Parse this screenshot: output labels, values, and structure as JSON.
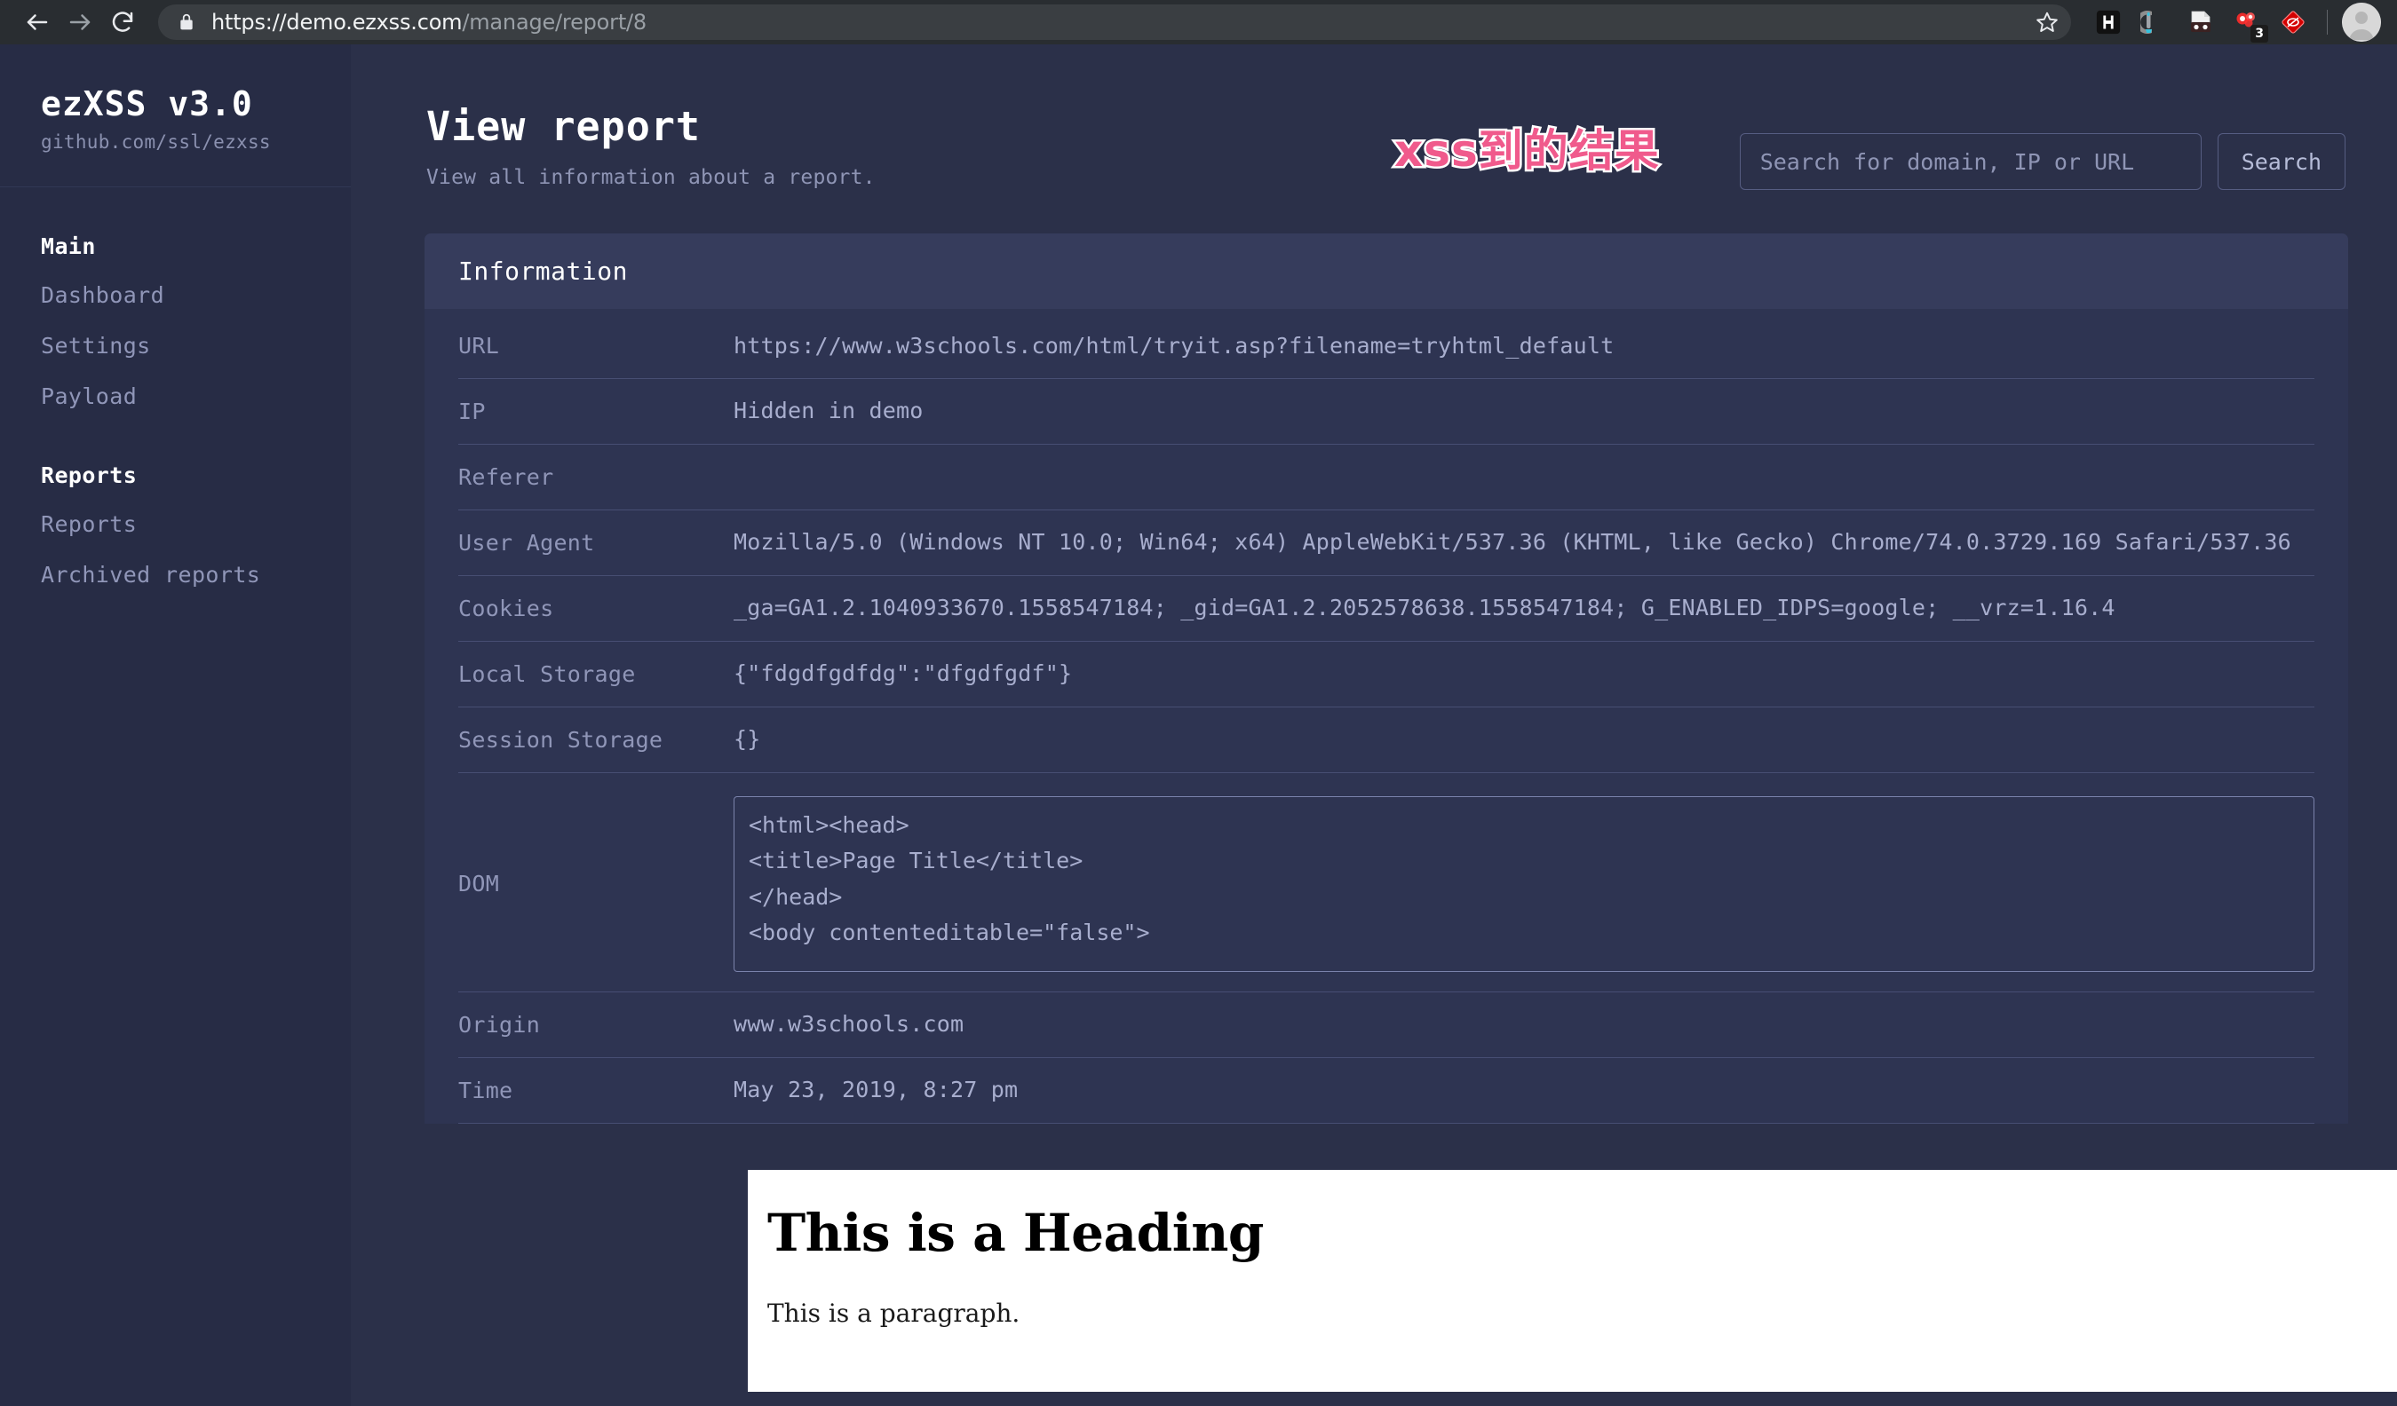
{
  "browser": {
    "back_icon": "back-arrow-icon",
    "forward_icon": "forward-arrow-icon",
    "reload_icon": "reload-icon",
    "lock_icon": "lock-icon",
    "url_scheme_host": "https://demo.ezxss.com",
    "url_path": "/manage/report/8",
    "star_icon": "bookmark-star-icon",
    "extensions": [
      {
        "name": "hackbar-extension-icon",
        "badge": ""
      },
      {
        "name": "wappalyzer-extension-icon",
        "badge": ""
      },
      {
        "name": "proxy-switcher-extension-icon",
        "badge": ""
      },
      {
        "name": "adblock-extension-icon",
        "badge": "3"
      },
      {
        "name": "noscript-extension-icon",
        "badge": ""
      }
    ],
    "profile_icon": "user-avatar-icon"
  },
  "sidebar": {
    "brand_title": "ezXSS v3.0",
    "brand_sub": "github.com/ssl/ezxss",
    "groups": [
      {
        "title": "Main",
        "items": [
          {
            "label": "Dashboard"
          },
          {
            "label": "Settings"
          },
          {
            "label": "Payload"
          }
        ]
      },
      {
        "title": "Reports",
        "items": [
          {
            "label": "Reports"
          },
          {
            "label": "Archived reports"
          }
        ]
      }
    ]
  },
  "header": {
    "title": "View report",
    "subtitle": "View all information about a report.",
    "annotation": "xss到的结果",
    "annotation_color": "#f05a8c",
    "annotation_outline_color": "#ffffff"
  },
  "search": {
    "placeholder": "Search for domain, IP or URL",
    "value": "",
    "button_label": "Search"
  },
  "card": {
    "title": "Information",
    "rows": [
      {
        "label": "URL",
        "value": "https://www.w3schools.com/html/tryit.asp?filename=tryhtml_default"
      },
      {
        "label": "IP",
        "value": "Hidden in demo"
      },
      {
        "label": "Referer",
        "value": ""
      },
      {
        "label": "User Agent",
        "value": "Mozilla/5.0 (Windows NT 10.0; Win64; x64) AppleWebKit/537.36 (KHTML, like Gecko) Chrome/74.0.3729.169 Safari/537.36"
      },
      {
        "label": "Cookies",
        "value": "_ga=GA1.2.1040933670.1558547184; _gid=GA1.2.2052578638.1558547184; G_ENABLED_IDPS=google; __vrz=1.16.4"
      },
      {
        "label": "Local Storage",
        "value": "{\"fdgdfgdfdg\":\"dfgdfgdf\"}"
      },
      {
        "label": "Session Storage",
        "value": "{}"
      }
    ],
    "dom_label": "DOM",
    "dom_value": "<html><head>\n<title>Page Title</title>\n</head>\n<body contenteditable=\"false\">\n",
    "tail_rows": [
      {
        "label": "Origin",
        "value": "www.w3schools.com"
      },
      {
        "label": "Time",
        "value": "May 23, 2019, 8:27 pm"
      }
    ]
  },
  "screenshot": {
    "heading": "This is a Heading",
    "paragraph": "This is a paragraph."
  },
  "colors": {
    "app_bg": "#2b3049",
    "sidebar_bg": "#272c45",
    "card_bg": "#2e3452",
    "card_header_bg": "#363c5c",
    "border": "#474e73",
    "text_muted": "#9096b8",
    "text_value": "#a8aece",
    "chrome_bg": "#292d31",
    "omnibox_bg": "#3a3e42"
  }
}
